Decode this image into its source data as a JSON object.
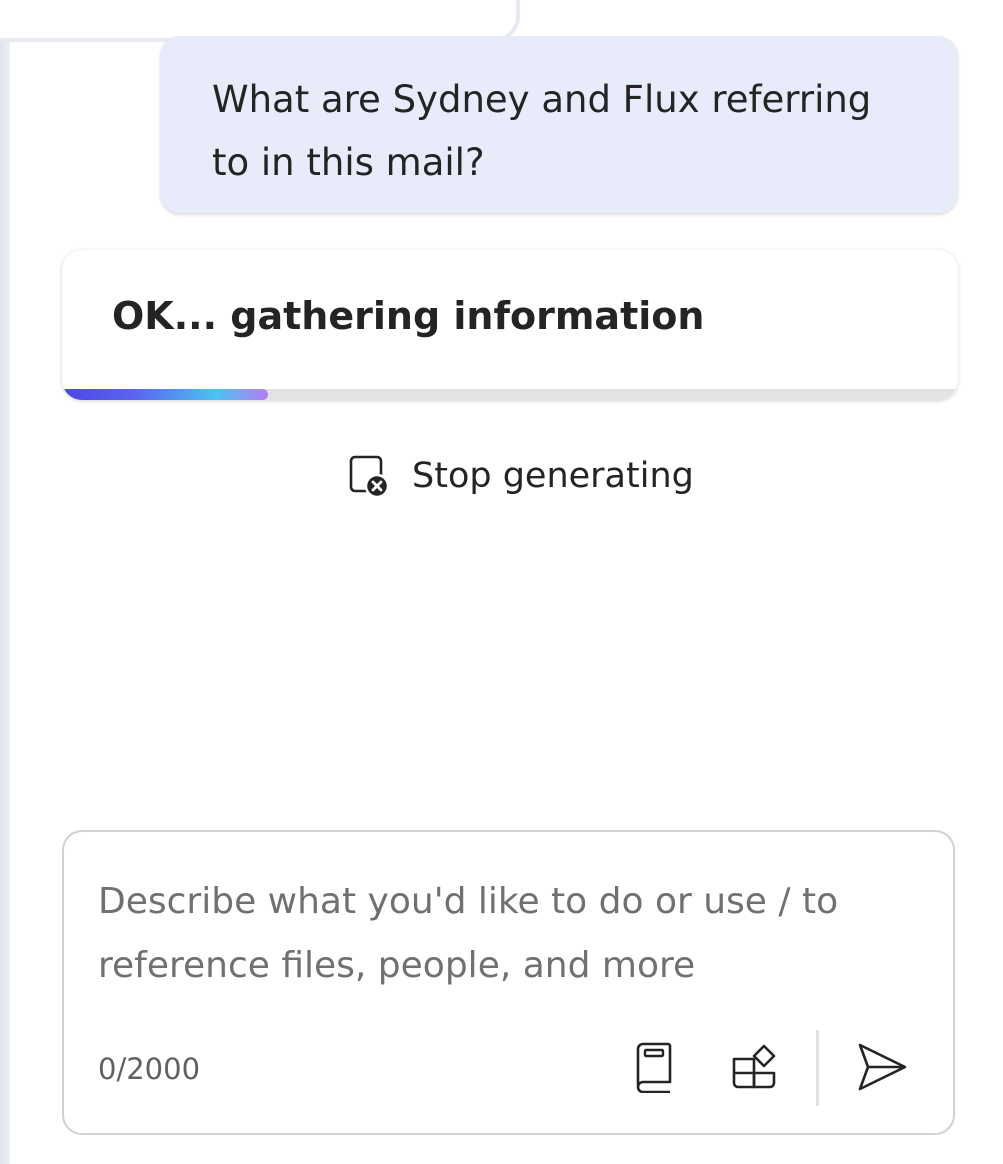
{
  "conversation": {
    "user_message": "What are Sydney and Flux referring to in this mail?",
    "status_message": "OK... gathering information",
    "progress": 0.23,
    "stop_label": "Stop generating"
  },
  "composer": {
    "placeholder": "Describe what you'd like to do or use / to reference files, people, and more",
    "value": "",
    "char_count": "0/2000",
    "tools": [
      "book-icon",
      "apps-icon",
      "send-icon"
    ]
  },
  "colors": {
    "user_bubble_bg": "#e8ebfa",
    "progress_gradient": [
      "#4f46e5",
      "#4cc3f0",
      "#b57df2"
    ],
    "progress_track": "#e3e3e3",
    "text": "#242424",
    "placeholder": "#707070"
  }
}
